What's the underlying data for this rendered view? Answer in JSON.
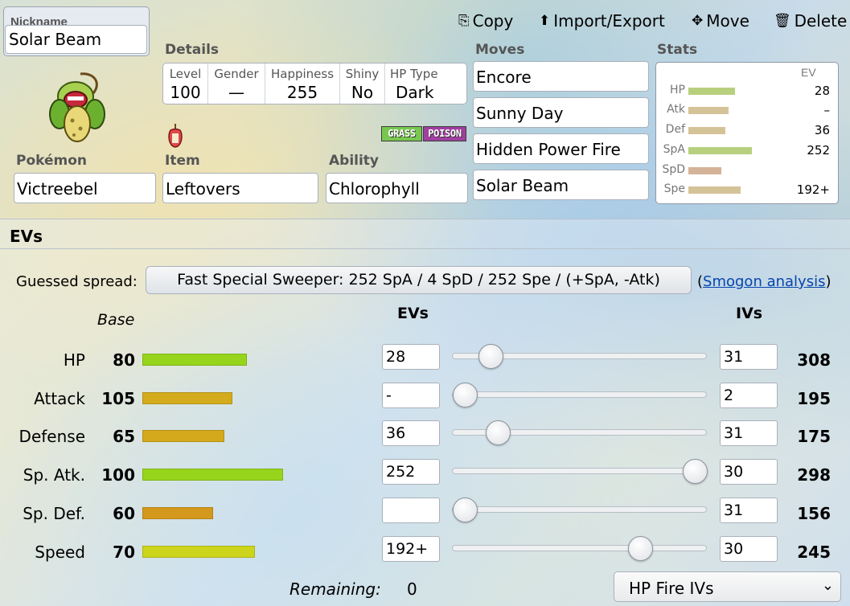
{
  "nickname": {
    "label": "Nickname",
    "value": "Solar Beam"
  },
  "actions": {
    "copy": "Copy",
    "import_export": "Import/Export",
    "move": "Move",
    "delete": "Delete"
  },
  "details": {
    "label": "Details",
    "level_label": "Level",
    "level": "100",
    "gender_label": "Gender",
    "gender": "—",
    "happiness_label": "Happiness",
    "happiness": "255",
    "shiny_label": "Shiny",
    "shiny": "No",
    "hptype_label": "HP Type",
    "hptype": "Dark"
  },
  "types": [
    {
      "name": "GRASS",
      "color": "#78c850"
    },
    {
      "name": "POISON",
      "color": "#a040a0"
    }
  ],
  "pokemon": {
    "label": "Pokémon",
    "value": "Victreebel"
  },
  "item": {
    "label": "Item",
    "value": "Leftovers"
  },
  "ability": {
    "label": "Ability",
    "value": "Chlorophyll"
  },
  "moves": {
    "label": "Moves",
    "list": [
      "Encore",
      "Sunny Day",
      "Hidden Power Fire",
      "Solar Beam"
    ]
  },
  "stats_panel": {
    "label": "Stats",
    "ev_header": "EV",
    "rows": [
      {
        "name": "HP",
        "ev": "28",
        "level": 0.24,
        "color": "#b8d07e"
      },
      {
        "name": "Atk",
        "ev": "–",
        "level": 0.21,
        "color": "#d5c398"
      },
      {
        "name": "Def",
        "ev": "36",
        "level": 0.19,
        "color": "#d5c398"
      },
      {
        "name": "SpA",
        "ev": "252",
        "level": 0.33,
        "color": "#b8d07e"
      },
      {
        "name": "SpD",
        "ev": "",
        "level": 0.17,
        "color": "#d5b398"
      },
      {
        "name": "Spe",
        "ev": "192+",
        "level": 0.27,
        "color": "#d5c398"
      }
    ]
  },
  "ev_section": {
    "title": "EVs",
    "guessed_label": "Guessed spread:",
    "guessed_value": "Fast Special Sweeper: 252 SpA / 4 SpD / 252 Spe / (+SpA, -Atk)",
    "smogon_open": "(",
    "smogon_link": "Smogon analysis",
    "smogon_close": ")",
    "base_header": "Base",
    "evs_header": "EVs",
    "ivs_header": "IVs",
    "rows": [
      {
        "name": "HP",
        "base": "80",
        "ev": "28",
        "iv": "31",
        "total": "308",
        "slider": 0.111,
        "bar_level": 0.37,
        "bar_color": "#97d41c"
      },
      {
        "name": "Attack",
        "base": "105",
        "ev": "-",
        "iv": "2",
        "total": "195",
        "slider": 0.0,
        "bar_level": 0.32,
        "bar_color": "#d4ab1c"
      },
      {
        "name": "Defense",
        "base": "65",
        "ev": "36",
        "iv": "31",
        "total": "175",
        "slider": 0.143,
        "bar_level": 0.29,
        "bar_color": "#d4a91c"
      },
      {
        "name": "Sp. Atk.",
        "base": "100",
        "ev": "252",
        "iv": "30",
        "total": "298",
        "slider": 1.0,
        "bar_level": 0.5,
        "bar_color": "#97d41c"
      },
      {
        "name": "Sp. Def.",
        "base": "60",
        "ev": "",
        "iv": "31",
        "total": "156",
        "slider": 0.0,
        "bar_level": 0.25,
        "bar_color": "#d4991c"
      },
      {
        "name": "Speed",
        "base": "70",
        "ev": "192+",
        "iv": "30",
        "total": "245",
        "slider": 0.762,
        "bar_level": 0.4,
        "bar_color": "#cdd41c"
      }
    ],
    "remaining_label": "Remaining:",
    "remaining_value": "0",
    "iv_preset": "HP Fire IVs"
  }
}
